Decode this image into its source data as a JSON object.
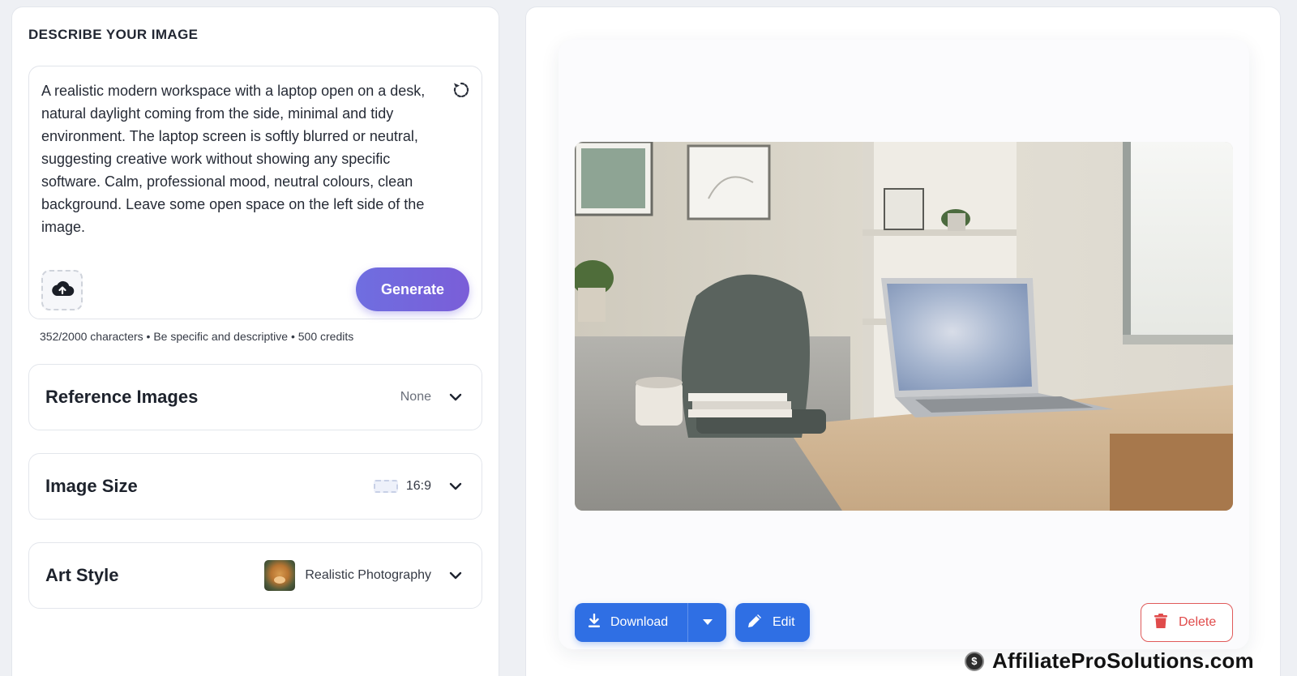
{
  "prompt_panel": {
    "heading": "DESCRIBE YOUR IMAGE",
    "prompt_text": "A realistic modern workspace with a laptop open on a desk, natural daylight coming from the side, minimal and tidy environment. The laptop screen is softly blurred or neutral, suggesting creative work without showing any specific software. Calm, professional mood, neutral colours, clean background. Leave some open space on the left side of the image.",
    "generate_label": "Generate",
    "char_info": "352/2000 characters • Be specific and descriptive • 500 credits",
    "reset_icon": "reset-icon",
    "upload_icon": "cloud-upload-icon"
  },
  "options": {
    "reference_images": {
      "title": "Reference Images",
      "value": "None"
    },
    "image_size": {
      "title": "Image Size",
      "value": "16:9",
      "icon": "aspect-ratio-icon"
    },
    "art_style": {
      "title": "Art Style",
      "value": "Realistic Photography",
      "thumb": "dog-photo-thumbnail"
    }
  },
  "result": {
    "image_description_icon": "generated-image",
    "download_label": "Download",
    "edit_label": "Edit",
    "delete_label": "Delete",
    "colors": {
      "primary": "#2f6fe4",
      "generate_gradient_start": "#6f6ee0",
      "generate_gradient_end": "#7a5ed8",
      "delete": "#e04b4b"
    }
  },
  "watermark": {
    "text": "AffiliateProSolutions.com",
    "icon": "dollar-coin-icon"
  }
}
